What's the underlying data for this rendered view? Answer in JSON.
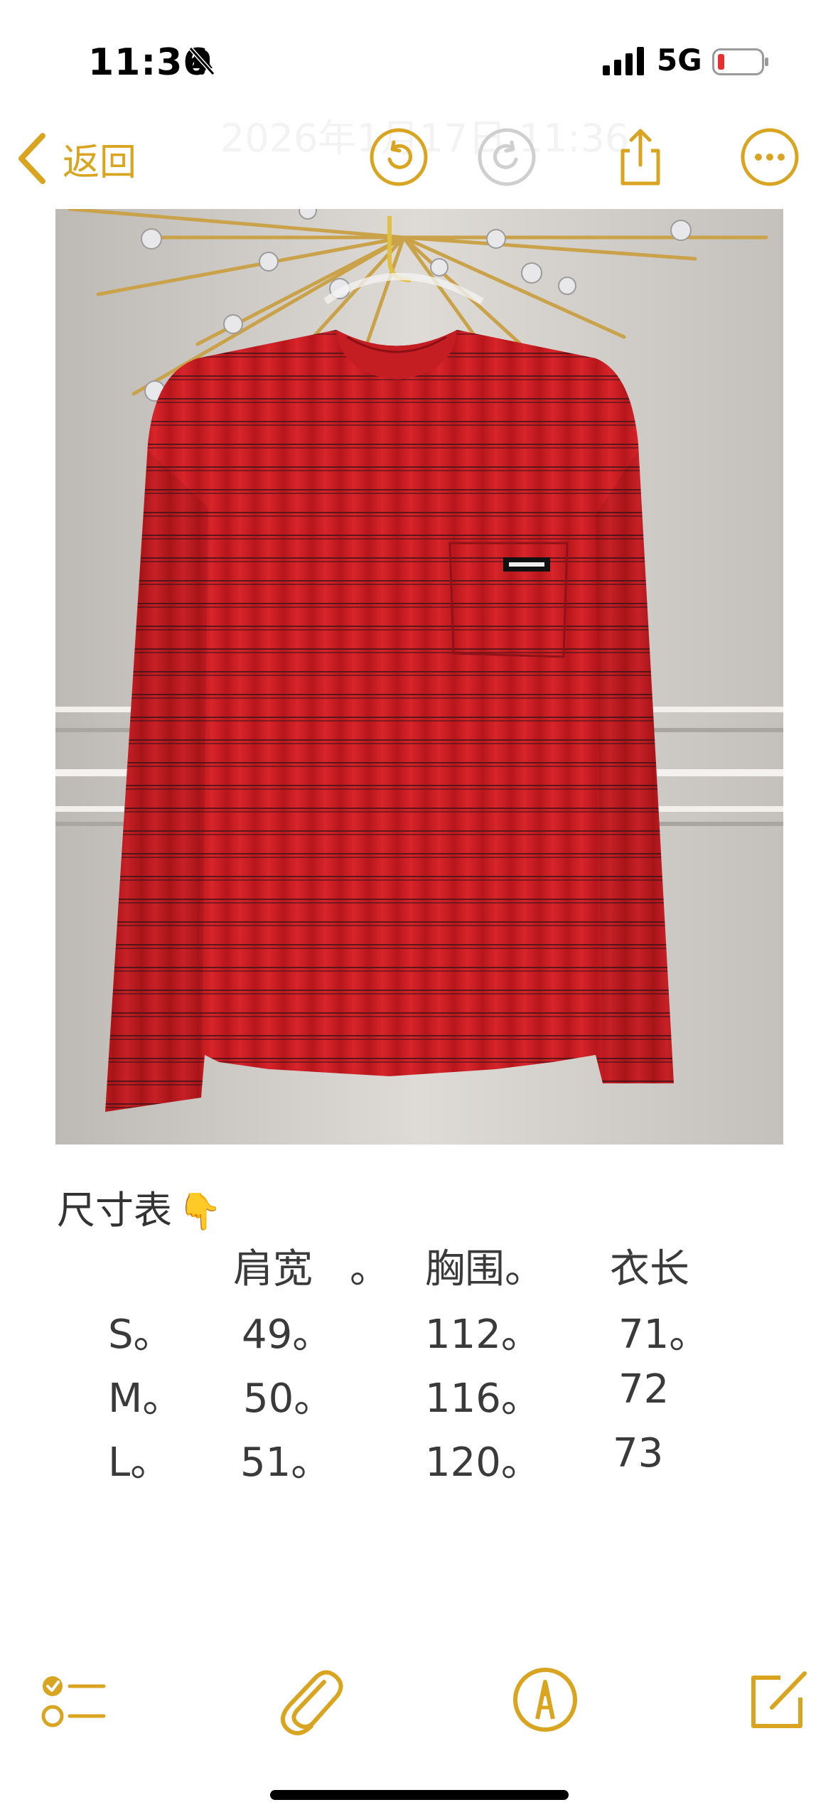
{
  "status_bar": {
    "time": "11:36",
    "network": "5G",
    "icons": [
      "bell-slash-icon",
      "signal-icon",
      "battery-icon"
    ]
  },
  "nav": {
    "back_label": "返回",
    "faded_header": "2026年1月17日 11:36",
    "buttons": [
      "undo-icon",
      "redo-icon",
      "share-icon",
      "more-icon"
    ],
    "accent_color": "#d9a520"
  },
  "note": {
    "heading": "尺寸表",
    "heading_emoji": "👇",
    "table": {
      "headers": [
        "肩宽",
        "。",
        "胸围。",
        "衣长"
      ],
      "rows": [
        {
          "size": "S。",
          "shoulder": "49。",
          "chest": "112。",
          "length": "71。"
        },
        {
          "size": "M。",
          "shoulder": "50。",
          "chest": "116。",
          "length": "72"
        },
        {
          "size": "L。",
          "shoulder": "51。",
          "chest": "120。",
          "length": "73"
        }
      ]
    }
  },
  "toolbar": {
    "icons": [
      "checklist-icon",
      "paperclip-icon",
      "markup-pen-icon",
      "compose-icon"
    ]
  }
}
